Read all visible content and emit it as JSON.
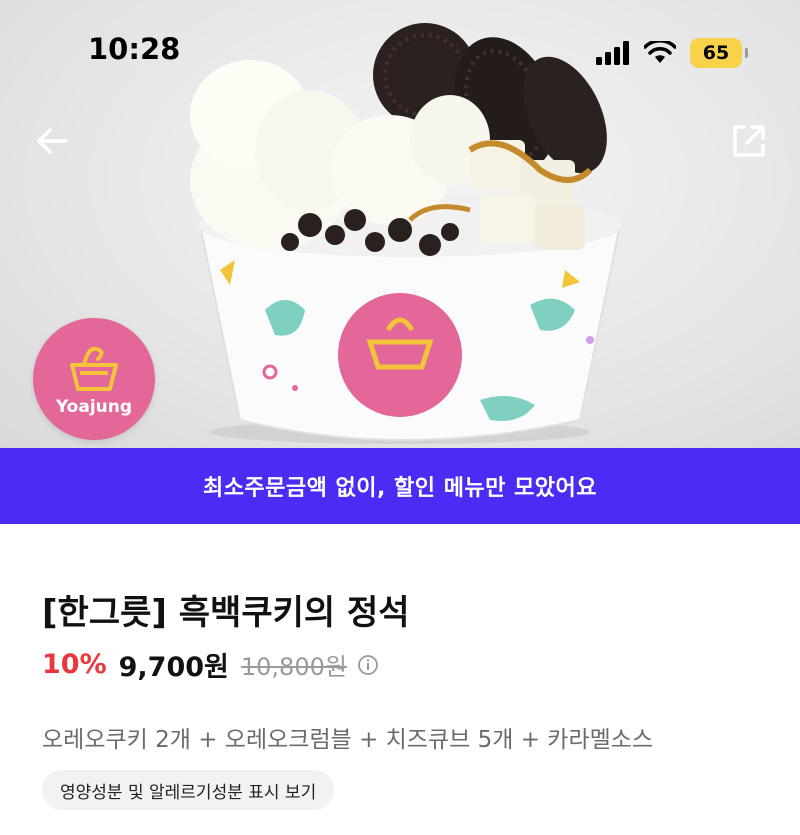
{
  "status": {
    "time": "10:28",
    "battery": "65"
  },
  "header": {
    "back_icon": "arrow-left-icon",
    "share_icon": "share-icon"
  },
  "brand": {
    "logo_text": "Yoajung",
    "logo_color": "#e4679a"
  },
  "promo": {
    "text": "최소주문금액 없이, 할인 메뉴만 모았어요",
    "color": "#4a2cf4"
  },
  "product": {
    "title": "[한그릇] 흑백쿠키의 정석",
    "discount": "10%",
    "price": "9,700원",
    "original_price": "10,800원",
    "description": "오레오쿠키 2개 + 오레오크럼블 + 치즈큐브 5개 + 카라멜소스",
    "nutrition_button": "영양성분 및 알레르기성분 표시 보기",
    "discount_color": "#e8383d"
  }
}
